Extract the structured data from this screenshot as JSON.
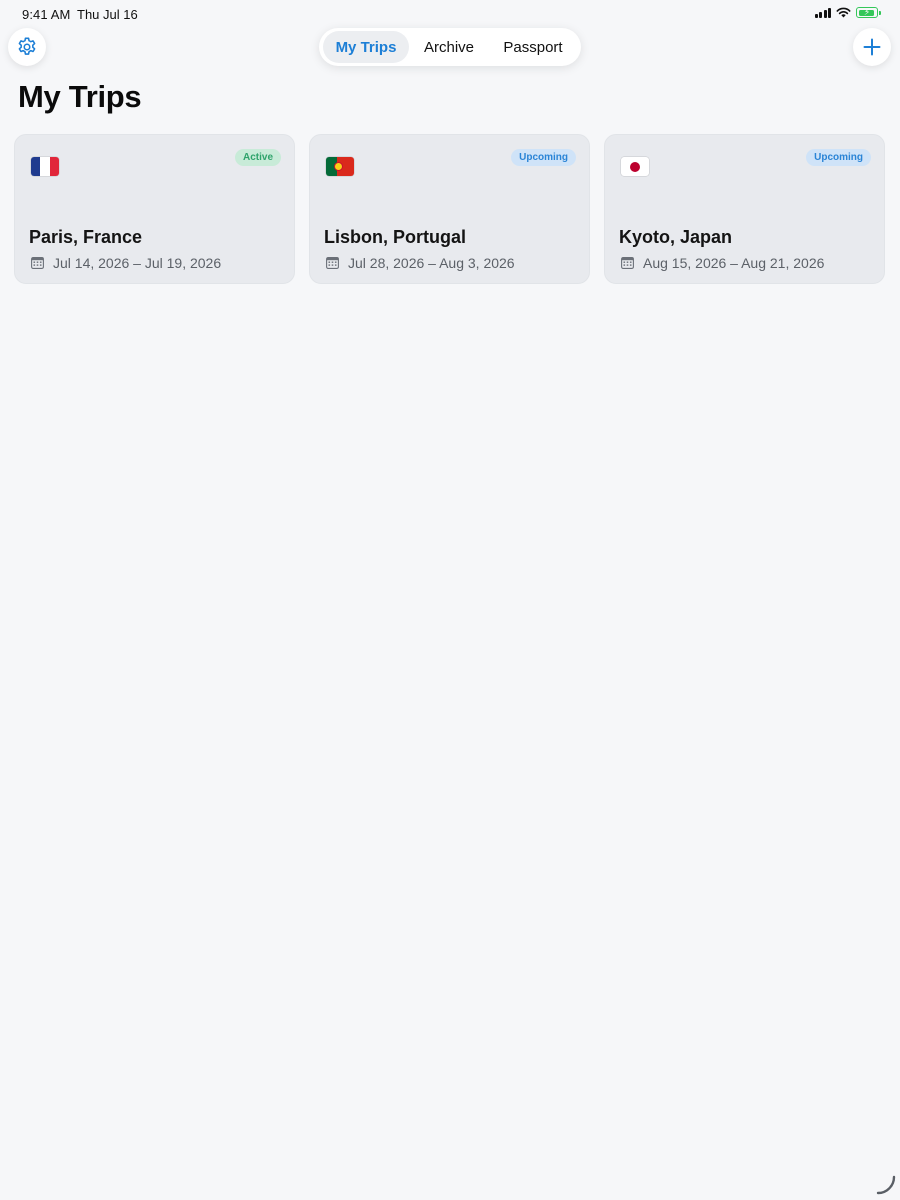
{
  "status_bar": {
    "time": "9:41 AM",
    "date": "Thu Jul 16",
    "icons": [
      "signal-icon",
      "wifi-icon",
      "battery-charging-icon"
    ],
    "battery_color": "#34c759"
  },
  "toolbar": {
    "settings_icon": "gear-icon",
    "add_icon": "plus-icon",
    "accent_color": "#1d7fd6"
  },
  "segmented_control": {
    "items": [
      {
        "label": "My Trips",
        "selected": true
      },
      {
        "label": "Archive",
        "selected": false
      },
      {
        "label": "Passport",
        "selected": false
      }
    ]
  },
  "page": {
    "title": "My Trips"
  },
  "trips": [
    {
      "flag": "france-flag-icon",
      "status": "Active",
      "status_color": "#2fa36b",
      "city": "Paris, France",
      "dates": "Jul 14, 2026 – Jul 19, 2026"
    },
    {
      "flag": "portugal-flag-icon",
      "status": "Upcoming",
      "status_color": "#2a84d6",
      "city": "Lisbon, Portugal",
      "dates": "Jul 28, 2026 – Aug 3, 2026"
    },
    {
      "flag": "japan-flag-icon",
      "status": "Upcoming",
      "status_color": "#2a84d6",
      "city": "Kyoto, Japan",
      "dates": "Aug 15, 2026 – Aug 21, 2026"
    }
  ]
}
